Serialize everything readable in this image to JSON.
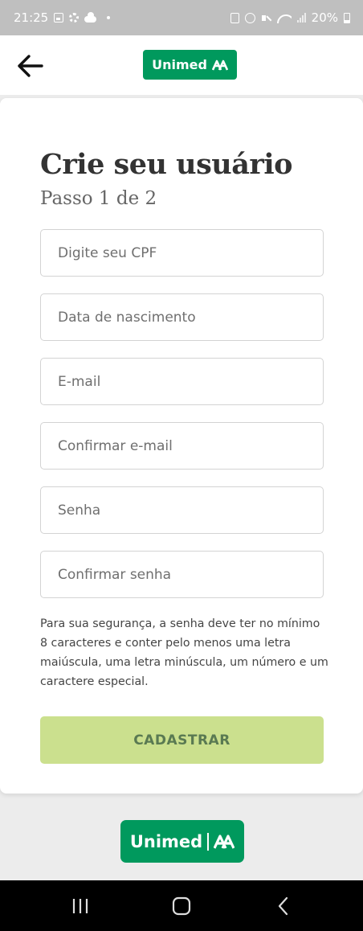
{
  "status_bar": {
    "time": "21:25",
    "battery_percent": "20%",
    "icons_left": [
      "image-icon",
      "gear-icon",
      "cloud-icon",
      "dot-icon"
    ],
    "icons_right": [
      "box-icon",
      "alarm-icon",
      "mute-icon",
      "wifi-icon",
      "signal-icon",
      "battery-icon"
    ]
  },
  "app_bar": {
    "back_icon": "arrow-left-icon",
    "logo_text": "Unimed"
  },
  "form": {
    "title": "Crie seu usuário",
    "subtitle": "Passo 1 de 2",
    "fields": [
      {
        "placeholder": "Digite seu CPF",
        "value": ""
      },
      {
        "placeholder": "Data de nascimento",
        "value": ""
      },
      {
        "placeholder": "E-mail",
        "value": ""
      },
      {
        "placeholder": "Confirmar e-mail",
        "value": ""
      },
      {
        "placeholder": "Senha",
        "value": ""
      },
      {
        "placeholder": "Confirmar senha",
        "value": ""
      }
    ],
    "password_hint": "Para sua segurança, a senha deve ter no mínimo 8 caracteres e conter pelo menos uma letra maiúscula, uma letra minúscula, um número e um caractere especial.",
    "submit_label": "CADASTRAR"
  },
  "footer": {
    "logo_text": "Unimed"
  },
  "nav_bar": {
    "buttons": [
      "recent-apps-icon",
      "home-icon",
      "back-icon"
    ]
  },
  "colors": {
    "brand_green": "#00995d",
    "submit_disabled": "#cbe08e",
    "status_bar_bg": "#bfbfbf"
  }
}
